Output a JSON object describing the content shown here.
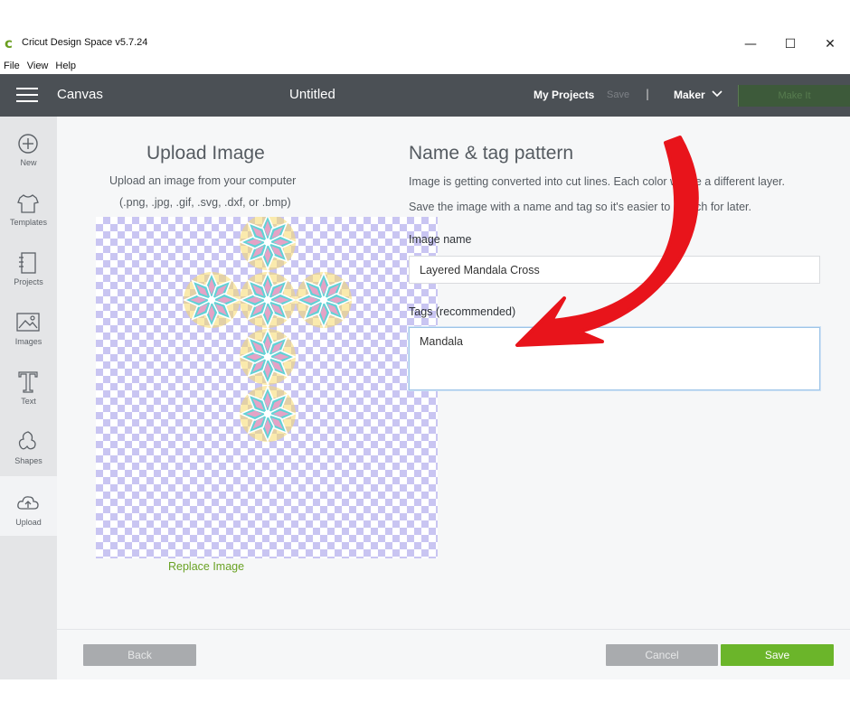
{
  "window": {
    "app_title": "Cricut Design Space  v5.7.24",
    "logo_glyph": "c",
    "minimize": "—",
    "maximize": "☐",
    "close": "✕"
  },
  "menu": [
    "File",
    "View",
    "Help"
  ],
  "header": {
    "canvas_label": "Canvas",
    "document_title": "Untitled",
    "my_projects": "My Projects",
    "save": "Save",
    "separator": "|",
    "machine": "Maker",
    "make_it": "Make It"
  },
  "sidebar": {
    "items": [
      {
        "label": "New",
        "icon": "plus-circle-icon"
      },
      {
        "label": "Templates",
        "icon": "shirt-icon"
      },
      {
        "label": "Projects",
        "icon": "notebook-icon"
      },
      {
        "label": "Images",
        "icon": "image-icon"
      },
      {
        "label": "Text",
        "icon": "text-icon"
      },
      {
        "label": "Shapes",
        "icon": "shapes-icon"
      },
      {
        "label": "Upload",
        "icon": "cloud-upload-icon"
      }
    ],
    "active": "Upload"
  },
  "upload": {
    "title": "Upload Image",
    "desc_line1": "Upload an image from your computer",
    "desc_line2": "(.png, .jpg, .gif, .svg, .dxf, or .bmp)",
    "replace_link": "Replace Image"
  },
  "naming": {
    "title": "Name & tag pattern",
    "desc_line1": "Image is getting converted into cut lines. Each color will be a different layer.",
    "desc_line2": "Save the image with a name and tag so it's easier to search for later.",
    "image_name_label": "Image name",
    "image_name_value": "Layered Mandala Cross",
    "tags_label": "Tags (recommended)",
    "tags_value": "Mandala"
  },
  "footer": {
    "back": "Back",
    "cancel": "Cancel",
    "save": "Save"
  },
  "colors": {
    "header_bg": "#4b5055",
    "accent_green": "#6bb52a",
    "arrow_red": "#e8141b",
    "checker": "#c9c5f2",
    "mandala_cyan": "#5fd3d6",
    "mandala_pink": "#e4a3c6",
    "mandala_yellow": "#f6d96a"
  }
}
